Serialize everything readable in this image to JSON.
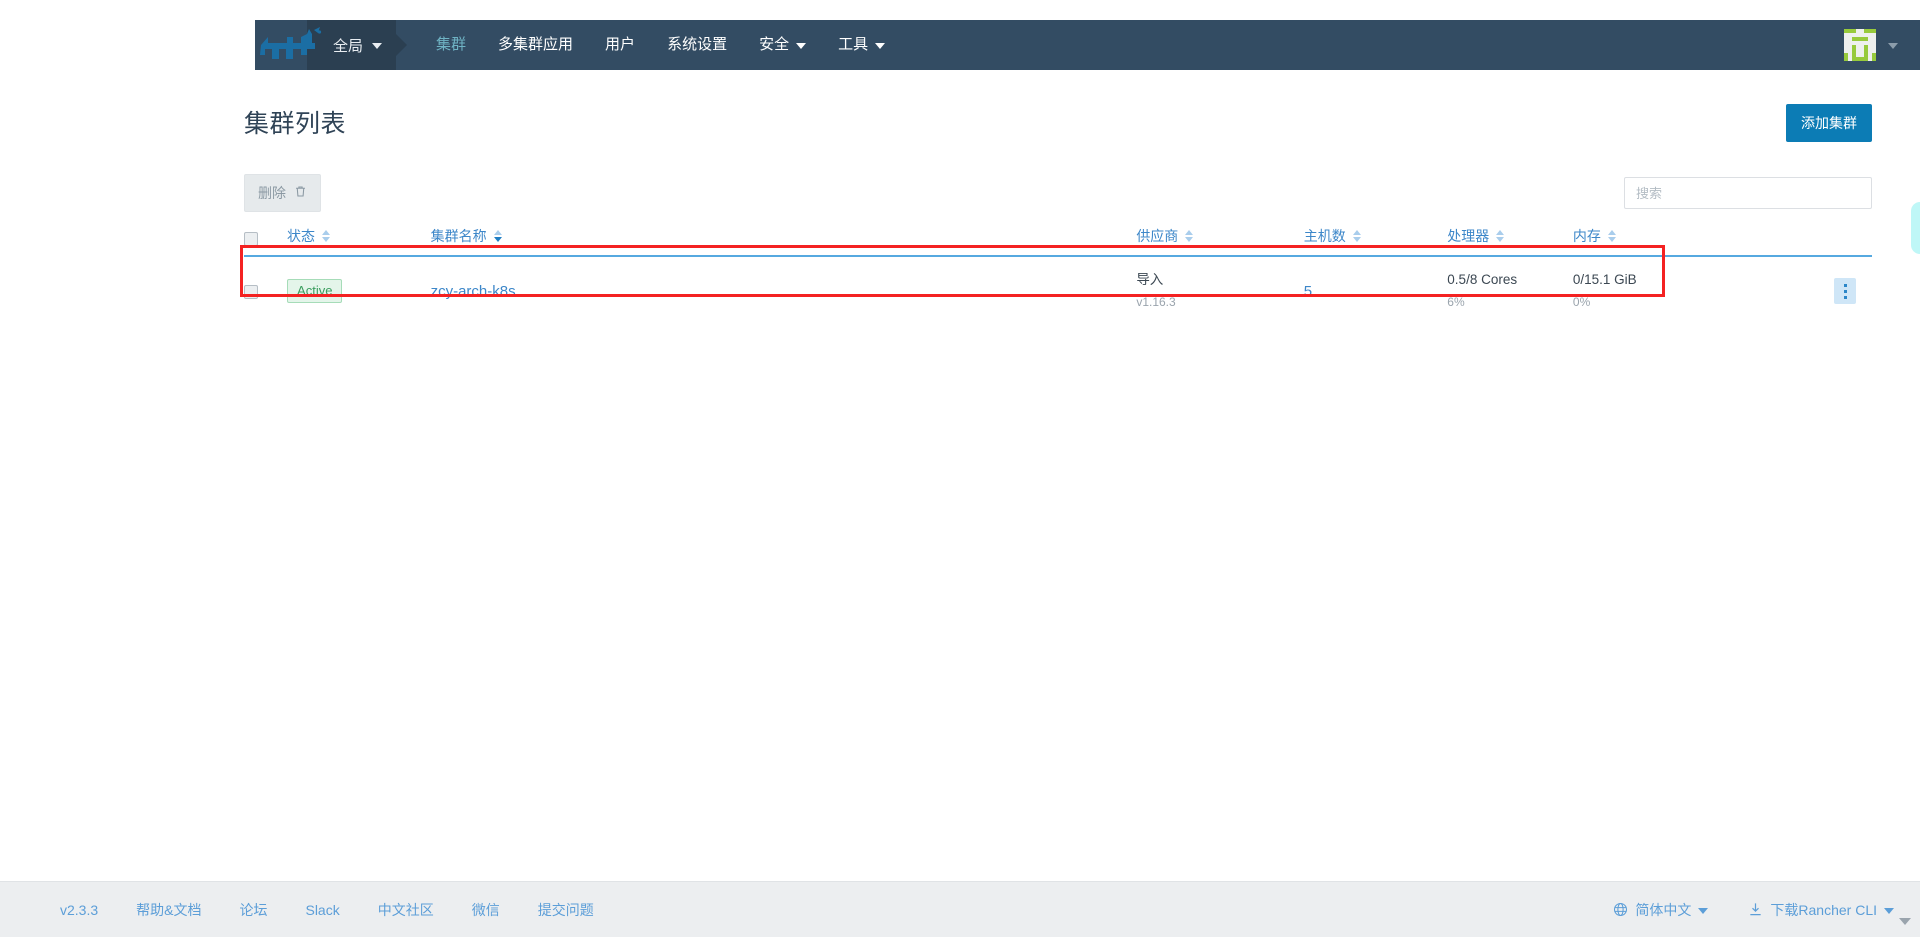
{
  "navbar": {
    "logo_icon": "rancher-cow-logo",
    "scope": {
      "label": "全局",
      "caret_icon": "chevron-down-icon"
    },
    "links": [
      {
        "label": "集群",
        "active": true,
        "has_caret": false,
        "name": "nav-link-clusters"
      },
      {
        "label": "多集群应用",
        "active": false,
        "has_caret": false,
        "name": "nav-link-multi-cluster-apps"
      },
      {
        "label": "用户",
        "active": false,
        "has_caret": false,
        "name": "nav-link-users"
      },
      {
        "label": "系统设置",
        "active": false,
        "has_caret": false,
        "name": "nav-link-settings"
      },
      {
        "label": "安全",
        "active": false,
        "has_caret": true,
        "name": "nav-link-security"
      },
      {
        "label": "工具",
        "active": false,
        "has_caret": true,
        "name": "nav-link-tools"
      }
    ],
    "user": {
      "avatar_icon": "user-avatar-identicon",
      "caret_icon": "chevron-down-icon"
    }
  },
  "page": {
    "title": "集群列表",
    "add_button": "添加集群"
  },
  "toolbar": {
    "delete_label": "删除",
    "delete_icon": "trash-icon",
    "search_placeholder": "搜索",
    "search_value": ""
  },
  "table": {
    "columns": [
      {
        "label": "状态",
        "name": "column-state",
        "sorted": false
      },
      {
        "label": "集群名称",
        "name": "column-cluster-name",
        "sorted": true
      },
      {
        "label": "供应商",
        "name": "column-provider",
        "sorted": false
      },
      {
        "label": "主机数",
        "name": "column-node-count",
        "sorted": false
      },
      {
        "label": "处理器",
        "name": "column-cpu",
        "sorted": false
      },
      {
        "label": "内存",
        "name": "column-memory",
        "sorted": false
      }
    ],
    "rows": [
      {
        "state": "Active",
        "name": "zcy-arch-k8s",
        "provider": "导入",
        "provider_version": "v1.16.3",
        "nodes": "5",
        "cpu": "0.5/8 Cores",
        "cpu_pct": "6%",
        "memory": "0/15.1 GiB",
        "memory_pct": "0%",
        "actions_icon": "vertical-dots-icon"
      }
    ]
  },
  "footer": {
    "left_links": [
      {
        "label": "v2.3.3",
        "name": "footer-version"
      },
      {
        "label": "帮助&文档",
        "name": "footer-docs"
      },
      {
        "label": "论坛",
        "name": "footer-forums"
      },
      {
        "label": "Slack",
        "name": "footer-slack"
      },
      {
        "label": "中文社区",
        "name": "footer-chinese-community"
      },
      {
        "label": "微信",
        "name": "footer-wechat"
      },
      {
        "label": "提交问题",
        "name": "footer-file-issue"
      }
    ],
    "language": {
      "label": "简体中文",
      "icon": "globe-icon",
      "caret_icon": "chevron-down-icon"
    },
    "cli": {
      "label": "下载Rancher CLI",
      "icon": "download-icon",
      "caret_icon": "chevron-down-icon"
    }
  },
  "colors": {
    "nav_bg": "#334c63",
    "nav_scope_bg": "#2b3f51",
    "accent_blue": "#3d87c9",
    "primary_button": "#0c7cb5",
    "active_badge_text": "#3a9d5d",
    "active_badge_bg": "#e4f5ea",
    "annotation_red": "#f42222",
    "avatar_green": "#97ca3c"
  }
}
